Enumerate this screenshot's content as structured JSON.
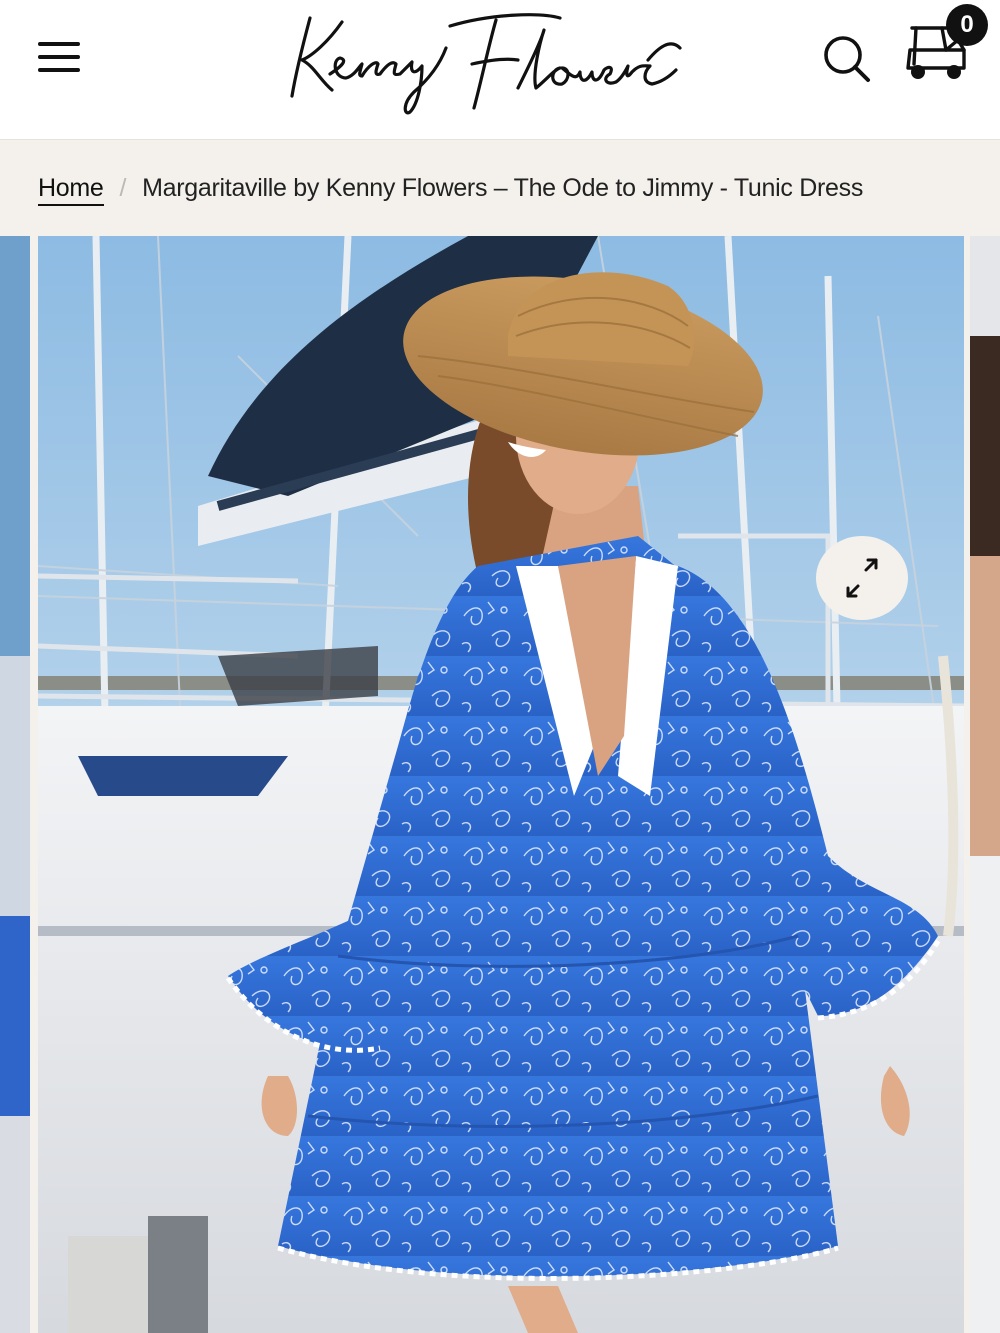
{
  "header": {
    "logo_text": "Kenny Flowers",
    "menu_icon": "hamburger-menu-icon",
    "search_icon": "search-icon",
    "cart_icon": "golf-cart-icon",
    "cart_count": "0"
  },
  "breadcrumb": {
    "home": "Home",
    "separator": "/",
    "current": "Margaritaville by Kenny Flowers – The Ode to Jimmy - Tunic Dress"
  },
  "gallery": {
    "expand_icon": "expand-arrows-icon",
    "image_alt": "Woman in blue floral tunic dress and straw hat on a marina dock"
  },
  "colors": {
    "header_bg": "#ffffff",
    "breadcrumb_bg": "#f4f1ed",
    "text": "#111111",
    "dress_blue": "#2f6fd6",
    "sky": "#a9cbe6"
  }
}
